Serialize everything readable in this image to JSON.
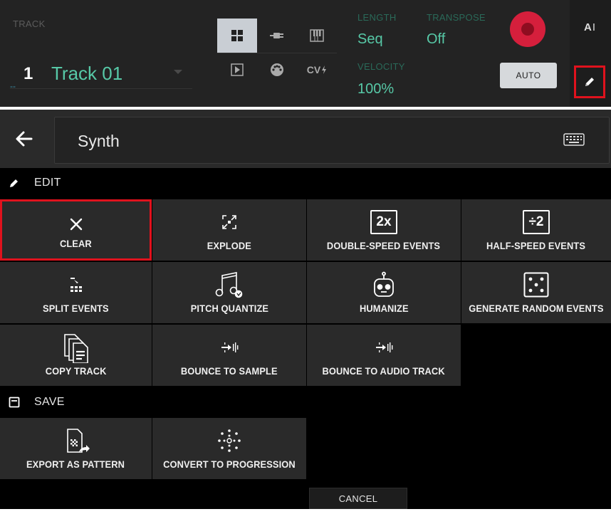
{
  "topbar": {
    "track_label": "TRACK",
    "track_number": "1",
    "track_number_sub": "--",
    "track_name": "Track 01",
    "length_label": "LENGTH",
    "length_value": "Seq",
    "transpose_label": "TRANSPOSE",
    "transpose_value": "Off",
    "velocity_label": "VELOCITY",
    "velocity_value": "100%",
    "auto_label": "AUTO",
    "cv_label": "CV",
    "text_tool_label": "A",
    "modes": [
      "grid",
      "plug",
      "keys",
      "clip",
      "midi",
      "cv"
    ],
    "active_mode": "grid"
  },
  "header": {
    "name_value": "Synth"
  },
  "edit_section": {
    "title": "EDIT",
    "items": [
      {
        "label": "CLEAR",
        "icon": "clear-x-icon",
        "selected": true
      },
      {
        "label": "EXPLODE",
        "icon": "explode-icon"
      },
      {
        "label": "DOUBLE-SPEED EVENTS",
        "icon": "double-speed-icon",
        "icon_text": "2x"
      },
      {
        "label": "HALF-SPEED EVENTS",
        "icon": "half-speed-icon",
        "icon_text": "÷2"
      },
      {
        "label": "SPLIT EVENTS",
        "icon": "split-events-icon"
      },
      {
        "label": "PITCH QUANTIZE",
        "icon": "pitch-quantize-icon"
      },
      {
        "label": "HUMANIZE",
        "icon": "humanize-robot-icon"
      },
      {
        "label": "GENERATE RANDOM EVENTS",
        "icon": "dice-icon"
      },
      {
        "label": "COPY TRACK",
        "icon": "copy-track-icon"
      },
      {
        "label": "BOUNCE TO SAMPLE",
        "icon": "bounce-sample-icon"
      },
      {
        "label": "BOUNCE TO AUDIO TRACK",
        "icon": "bounce-audio-icon"
      }
    ]
  },
  "save_section": {
    "title": "SAVE",
    "items": [
      {
        "label": "EXPORT AS PATTERN",
        "icon": "export-pattern-icon"
      },
      {
        "label": "CONVERT TO PROGRESSION",
        "icon": "convert-progression-icon"
      }
    ]
  },
  "footer": {
    "cancel_label": "CANCEL"
  },
  "colors": {
    "accent_green": "#57c9a7",
    "record_red": "#d51f3c",
    "highlight_red": "#e0121d",
    "tile_bg": "#2a2a2a"
  }
}
